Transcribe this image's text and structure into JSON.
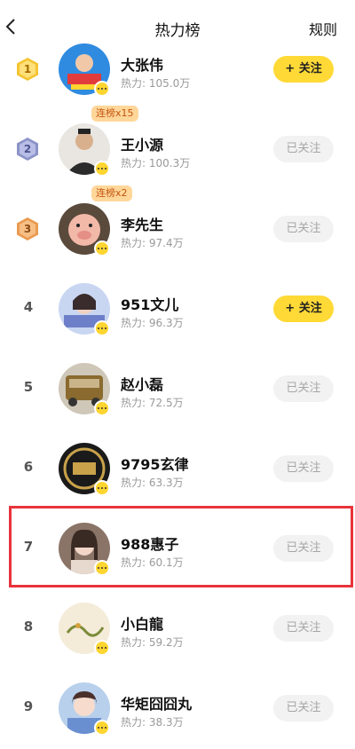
{
  "header": {
    "title": "热力榜",
    "rules_label": "规则"
  },
  "ranking": [
    {
      "rank": "1",
      "name": "大张伟",
      "heat": "热力: 105.0万",
      "streak": "",
      "button": "+ 关注",
      "followed": false,
      "medal_color": "#f5c432"
    },
    {
      "rank": "2",
      "name": "王小源",
      "heat": "热力: 100.3万",
      "streak": "连榜x15",
      "button": "已关注",
      "followed": true,
      "medal_color": "#8b93c8"
    },
    {
      "rank": "3",
      "name": "李先生",
      "heat": "热力: 97.4万",
      "streak": "连榜x2",
      "button": "已关注",
      "followed": true,
      "medal_color": "#e99a50"
    },
    {
      "rank": "4",
      "name": "951文儿",
      "heat": "热力: 96.3万",
      "streak": "",
      "button": "+ 关注",
      "followed": false
    },
    {
      "rank": "5",
      "name": "赵小磊",
      "heat": "热力: 72.5万",
      "streak": "",
      "button": "已关注",
      "followed": true
    },
    {
      "rank": "6",
      "name": "9795玄律",
      "heat": "热力: 63.3万",
      "streak": "",
      "button": "已关注",
      "followed": true
    },
    {
      "rank": "7",
      "name": "988惠子",
      "heat": "热力: 60.1万",
      "streak": "",
      "button": "已关注",
      "followed": true
    },
    {
      "rank": "8",
      "name": "小白龍",
      "heat": "热力: 59.2万",
      "streak": "",
      "button": "已关注",
      "followed": true
    },
    {
      "rank": "9",
      "name": "华矩囧囧丸",
      "heat": "热力: 38.3万",
      "streak": "",
      "button": "已关注",
      "followed": true
    }
  ],
  "colors": {
    "accent_yellow": "#ffd936",
    "highlight_red": "#e8333a",
    "streak_bg": "#ffd79a"
  }
}
